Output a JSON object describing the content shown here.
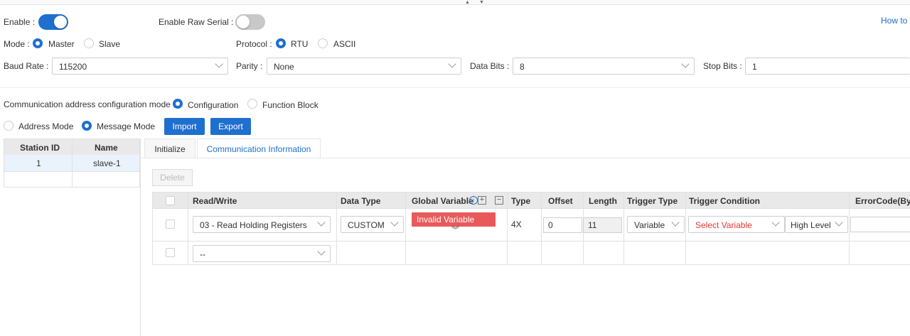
{
  "top": {
    "enable_label": "Enable :",
    "enable_raw_serial_label": "Enable Raw Serial :",
    "how_to_link": "How to v"
  },
  "mode": {
    "label": "Mode :",
    "options": [
      "Master",
      "Slave"
    ],
    "selected": "Master"
  },
  "protocol": {
    "label": "Protocol :",
    "options": [
      "RTU",
      "ASCII"
    ],
    "selected": "RTU"
  },
  "serial": {
    "baud_label": "Baud Rate :",
    "baud_value": "115200",
    "parity_label": "Parity :",
    "parity_value": "None",
    "data_bits_label": "Data Bits :",
    "data_bits_value": "8",
    "stop_bits_label": "Stop Bits :",
    "stop_bits_value": "1"
  },
  "comm_config": {
    "label": "Communication address configuration mode :",
    "options": [
      "Configuration",
      "Function Block"
    ],
    "selected": "Configuration"
  },
  "address_mode": {
    "options": [
      "Address Mode",
      "Message Mode"
    ],
    "selected": "Message Mode",
    "import_label": "Import",
    "export_label": "Export"
  },
  "station_table": {
    "headers": [
      "Station ID",
      "Name"
    ],
    "rows": [
      [
        "1",
        "slave-1"
      ]
    ]
  },
  "tabs": [
    {
      "label": "Initialize",
      "active": false
    },
    {
      "label": "Communication Information",
      "active": true
    }
  ],
  "delete_label": "Delete",
  "comm_table": {
    "headers": {
      "read_write": "Read/Write",
      "data_type": "Data Type",
      "global_variable": "Global Variable",
      "type": "Type",
      "offset": "Offset",
      "length": "Length",
      "trigger_type": "Trigger Type",
      "trigger_condition": "Trigger Condition",
      "error_code": "ErrorCode(Byte"
    },
    "row1": {
      "read_write": "03 - Read Holding Registers",
      "data_type": "CUSTOM",
      "global_variable_status": "Invalid Variable",
      "type": "4X",
      "offset": "0",
      "length": "11",
      "trigger_type": "Variable",
      "trigger_condition": "Select Variable",
      "trigger_level": "High Level"
    },
    "row2": {
      "read_write": "--"
    }
  },
  "colors": {
    "accent": "#1f6fcf",
    "invalid": "#e85a5a",
    "select_variable_text": "#e53935"
  }
}
